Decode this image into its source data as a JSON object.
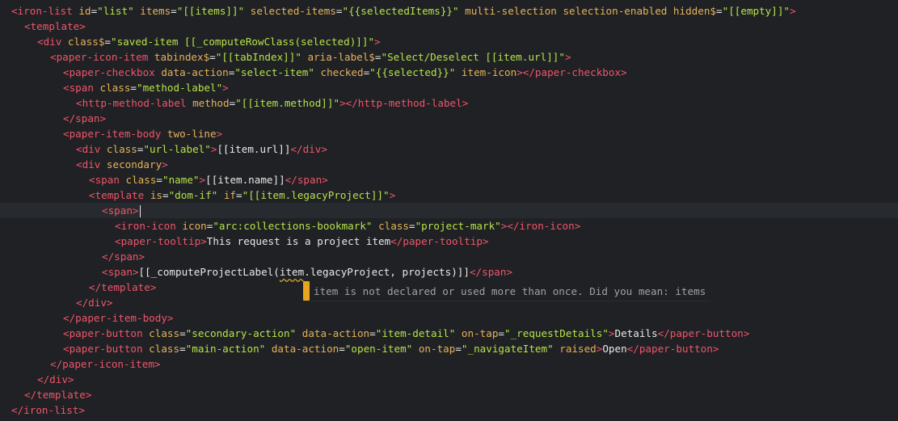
{
  "editor": {
    "lines": [
      {
        "indent": 0,
        "tokens": [
          {
            "c": "t-tag",
            "t": "<iron-list"
          },
          {
            "c": "t-attr",
            "t": " id"
          },
          {
            "c": "t-punc",
            "t": "="
          },
          {
            "c": "t-str",
            "t": "\"list\""
          },
          {
            "c": "t-attr",
            "t": " items"
          },
          {
            "c": "t-punc",
            "t": "="
          },
          {
            "c": "t-str",
            "t": "\"[[items]]\""
          },
          {
            "c": "t-attr",
            "t": " selected-items"
          },
          {
            "c": "t-punc",
            "t": "="
          },
          {
            "c": "t-str",
            "t": "\"{{selectedItems}}\""
          },
          {
            "c": "t-attr",
            "t": " multi-selection selection-enabled hidden$"
          },
          {
            "c": "t-punc",
            "t": "="
          },
          {
            "c": "t-str",
            "t": "\"[[empty]]\""
          },
          {
            "c": "t-tag",
            "t": ">"
          }
        ]
      },
      {
        "indent": 1,
        "tokens": [
          {
            "c": "t-tag",
            "t": "<template>"
          }
        ]
      },
      {
        "indent": 2,
        "tokens": [
          {
            "c": "t-tag",
            "t": "<div"
          },
          {
            "c": "t-attr",
            "t": " class$"
          },
          {
            "c": "t-punc",
            "t": "="
          },
          {
            "c": "t-str",
            "t": "\"saved-item [[_computeRowClass(selected)]]\""
          },
          {
            "c": "t-tag",
            "t": ">"
          }
        ]
      },
      {
        "indent": 3,
        "tokens": [
          {
            "c": "t-tag",
            "t": "<paper-icon-item"
          },
          {
            "c": "t-attr",
            "t": " tabindex$"
          },
          {
            "c": "t-punc",
            "t": "="
          },
          {
            "c": "t-str",
            "t": "\"[[tabIndex]]\""
          },
          {
            "c": "t-attr",
            "t": " aria-label$"
          },
          {
            "c": "t-punc",
            "t": "="
          },
          {
            "c": "t-str",
            "t": "\"Select/Deselect [[item.url]]\""
          },
          {
            "c": "t-tag",
            "t": ">"
          }
        ]
      },
      {
        "indent": 4,
        "tokens": [
          {
            "c": "t-tag",
            "t": "<paper-checkbox"
          },
          {
            "c": "t-attr",
            "t": " data-action"
          },
          {
            "c": "t-punc",
            "t": "="
          },
          {
            "c": "t-str",
            "t": "\"select-item\""
          },
          {
            "c": "t-attr",
            "t": " checked"
          },
          {
            "c": "t-punc",
            "t": "="
          },
          {
            "c": "t-str",
            "t": "\"{{selected}}\""
          },
          {
            "c": "t-attr",
            "t": " item-icon"
          },
          {
            "c": "t-tag",
            "t": "></paper-checkbox>"
          }
        ]
      },
      {
        "indent": 4,
        "tokens": [
          {
            "c": "t-tag",
            "t": "<span"
          },
          {
            "c": "t-attr",
            "t": " class"
          },
          {
            "c": "t-punc",
            "t": "="
          },
          {
            "c": "t-str",
            "t": "\"method-label\""
          },
          {
            "c": "t-tag",
            "t": ">"
          }
        ]
      },
      {
        "indent": 5,
        "tokens": [
          {
            "c": "t-tag",
            "t": "<http-method-label"
          },
          {
            "c": "t-attr",
            "t": " method"
          },
          {
            "c": "t-punc",
            "t": "="
          },
          {
            "c": "t-str",
            "t": "\"[[item.method]]\""
          },
          {
            "c": "t-tag",
            "t": "></http-method-label>"
          }
        ]
      },
      {
        "indent": 4,
        "tokens": [
          {
            "c": "t-tag",
            "t": "</span>"
          }
        ]
      },
      {
        "indent": 4,
        "tokens": [
          {
            "c": "t-tag",
            "t": "<paper-item-body"
          },
          {
            "c": "t-attr",
            "t": " two-line"
          },
          {
            "c": "t-tag",
            "t": ">"
          }
        ]
      },
      {
        "indent": 5,
        "tokens": [
          {
            "c": "t-tag",
            "t": "<div"
          },
          {
            "c": "t-attr",
            "t": " class"
          },
          {
            "c": "t-punc",
            "t": "="
          },
          {
            "c": "t-str",
            "t": "\"url-label\""
          },
          {
            "c": "t-tag",
            "t": ">"
          },
          {
            "c": "t-text",
            "t": "[[item.url]]"
          },
          {
            "c": "t-tag",
            "t": "</div>"
          }
        ]
      },
      {
        "indent": 5,
        "tokens": [
          {
            "c": "t-tag",
            "t": "<div"
          },
          {
            "c": "t-attr",
            "t": " secondary"
          },
          {
            "c": "t-tag",
            "t": ">"
          }
        ]
      },
      {
        "indent": 6,
        "tokens": [
          {
            "c": "t-tag",
            "t": "<span"
          },
          {
            "c": "t-attr",
            "t": " class"
          },
          {
            "c": "t-punc",
            "t": "="
          },
          {
            "c": "t-str",
            "t": "\"name\""
          },
          {
            "c": "t-tag",
            "t": ">"
          },
          {
            "c": "t-text",
            "t": "[[item.name]]"
          },
          {
            "c": "t-tag",
            "t": "</span>"
          }
        ]
      },
      {
        "indent": 6,
        "tokens": [
          {
            "c": "t-tag",
            "t": "<template"
          },
          {
            "c": "t-attr",
            "t": " is"
          },
          {
            "c": "t-punc",
            "t": "="
          },
          {
            "c": "t-str",
            "t": "\"dom-if\""
          },
          {
            "c": "t-attr",
            "t": " if"
          },
          {
            "c": "t-punc",
            "t": "="
          },
          {
            "c": "t-str",
            "t": "\"[[item.legacyProject]]\""
          },
          {
            "c": "t-tag",
            "t": ">"
          }
        ]
      },
      {
        "indent": 7,
        "current": true,
        "caret": true,
        "tokens": [
          {
            "c": "t-tag",
            "t": "<span>"
          }
        ]
      },
      {
        "indent": 8,
        "tokens": [
          {
            "c": "t-tag",
            "t": "<iron-icon"
          },
          {
            "c": "t-attr",
            "t": " icon"
          },
          {
            "c": "t-punc",
            "t": "="
          },
          {
            "c": "t-str",
            "t": "\"arc:collections-bookmark\""
          },
          {
            "c": "t-attr",
            "t": " class"
          },
          {
            "c": "t-punc",
            "t": "="
          },
          {
            "c": "t-str",
            "t": "\"project-mark\""
          },
          {
            "c": "t-tag",
            "t": "></iron-icon>"
          }
        ]
      },
      {
        "indent": 8,
        "tokens": [
          {
            "c": "t-tag",
            "t": "<paper-tooltip>"
          },
          {
            "c": "t-text",
            "t": "This request is a project item"
          },
          {
            "c": "t-tag",
            "t": "</paper-tooltip>"
          }
        ]
      },
      {
        "indent": 7,
        "tokens": [
          {
            "c": "t-tag",
            "t": "</span>"
          }
        ]
      },
      {
        "indent": 7,
        "tokens": [
          {
            "c": "t-tag",
            "t": "<span>"
          },
          {
            "c": "t-text",
            "t": "[[_computeProjectLabel("
          },
          {
            "c": "t-text t-warn",
            "t": "item"
          },
          {
            "c": "t-text",
            "t": ".legacyProject, projects)]]"
          },
          {
            "c": "t-tag",
            "t": "</span>"
          }
        ]
      },
      {
        "indent": 6,
        "tokens": [
          {
            "c": "t-tag",
            "t": "</template>"
          }
        ]
      },
      {
        "indent": 5,
        "tokens": [
          {
            "c": "t-tag",
            "t": "</div>"
          }
        ]
      },
      {
        "indent": 4,
        "tokens": [
          {
            "c": "t-tag",
            "t": "</paper-item-body>"
          }
        ]
      },
      {
        "indent": 4,
        "tokens": [
          {
            "c": "t-tag",
            "t": "<paper-button"
          },
          {
            "c": "t-attr",
            "t": " class"
          },
          {
            "c": "t-punc",
            "t": "="
          },
          {
            "c": "t-str",
            "t": "\"secondary-action\""
          },
          {
            "c": "t-attr",
            "t": " data-action"
          },
          {
            "c": "t-punc",
            "t": "="
          },
          {
            "c": "t-str",
            "t": "\"item-detail\""
          },
          {
            "c": "t-attr",
            "t": " on-tap"
          },
          {
            "c": "t-punc",
            "t": "="
          },
          {
            "c": "t-str",
            "t": "\"_requestDetails\""
          },
          {
            "c": "t-tag",
            "t": ">"
          },
          {
            "c": "t-text",
            "t": "Details"
          },
          {
            "c": "t-tag",
            "t": "</paper-button>"
          }
        ]
      },
      {
        "indent": 4,
        "tokens": [
          {
            "c": "t-tag",
            "t": "<paper-button"
          },
          {
            "c": "t-attr",
            "t": " class"
          },
          {
            "c": "t-punc",
            "t": "="
          },
          {
            "c": "t-str",
            "t": "\"main-action\""
          },
          {
            "c": "t-attr",
            "t": " data-action"
          },
          {
            "c": "t-punc",
            "t": "="
          },
          {
            "c": "t-str",
            "t": "\"open-item\""
          },
          {
            "c": "t-attr",
            "t": " on-tap"
          },
          {
            "c": "t-punc",
            "t": "="
          },
          {
            "c": "t-str",
            "t": "\"_navigateItem\""
          },
          {
            "c": "t-attr",
            "t": " raised"
          },
          {
            "c": "t-tag",
            "t": ">"
          },
          {
            "c": "t-text",
            "t": "Open"
          },
          {
            "c": "t-tag",
            "t": "</paper-button>"
          }
        ]
      },
      {
        "indent": 3,
        "tokens": [
          {
            "c": "t-tag",
            "t": "</paper-icon-item>"
          }
        ]
      },
      {
        "indent": 2,
        "tokens": [
          {
            "c": "t-tag",
            "t": "</div>"
          }
        ]
      },
      {
        "indent": 1,
        "tokens": [
          {
            "c": "t-tag",
            "t": "</template>"
          }
        ]
      },
      {
        "indent": 0,
        "tokens": [
          {
            "c": "t-tag",
            "t": "</iron-list>"
          }
        ]
      }
    ]
  },
  "lint": {
    "message": "item is not declared or used more than once. Did you mean: items",
    "marker_color": "#e7a61d"
  },
  "colors": {
    "background": "#1f2124",
    "tag": "#f0556a",
    "attribute": "#e5b25a",
    "string": "#b6e24a",
    "text": "#e8e8e8"
  }
}
